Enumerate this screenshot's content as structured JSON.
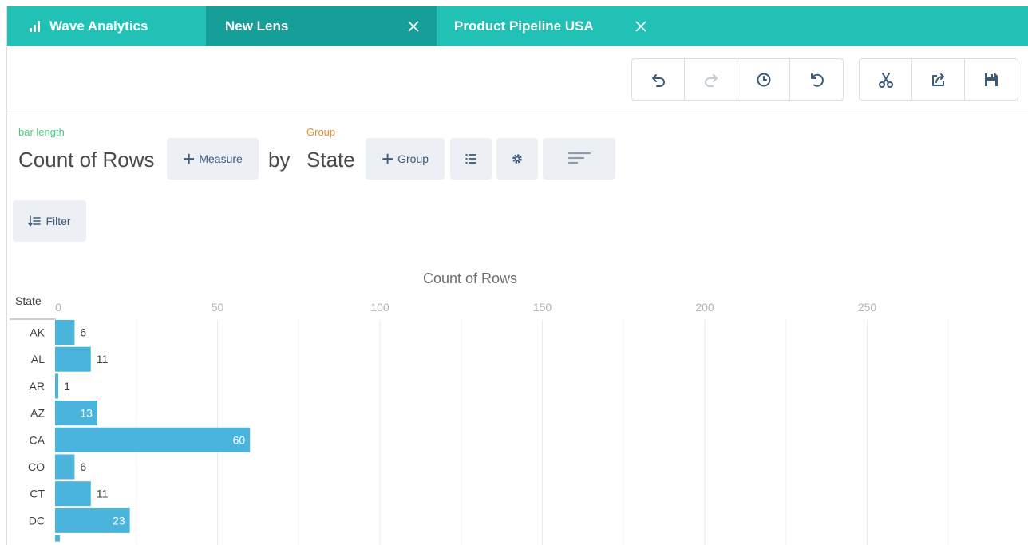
{
  "tabs": {
    "home": "Wave Analytics",
    "lens": "New Lens",
    "pipeline": "Product Pipeline USA"
  },
  "toolbar": {
    "history_icons": [
      "undo-icon",
      "redo-icon",
      "history-clock-icon",
      "reset-icon"
    ],
    "action_icons": [
      "clip-icon",
      "share-icon",
      "save-icon"
    ]
  },
  "query": {
    "measure_role": "bar length",
    "measure": "Count of Rows",
    "add_measure_label": "Measure",
    "by": "by",
    "group_role": "Group",
    "group": "State",
    "add_group_label": "Group",
    "filter_label": "Filter"
  },
  "colors": {
    "tabbar": "#21c1b5",
    "active_tab": "#169f98",
    "bar": "#4ab4dd",
    "measure_role": "#4bca81",
    "group_role": "#e58f2e"
  },
  "chart_data": {
    "type": "bar",
    "orientation": "horizontal",
    "title": "Count of Rows",
    "category_label": "State",
    "xlim": [
      0,
      280
    ],
    "xticks": [
      0,
      50,
      100,
      150,
      200,
      250
    ],
    "categories": [
      "AK",
      "AL",
      "AR",
      "AZ",
      "CA",
      "CO",
      "CT",
      "DC"
    ],
    "values": [
      6,
      11,
      1,
      13,
      60,
      6,
      11,
      23
    ],
    "grid": true
  }
}
